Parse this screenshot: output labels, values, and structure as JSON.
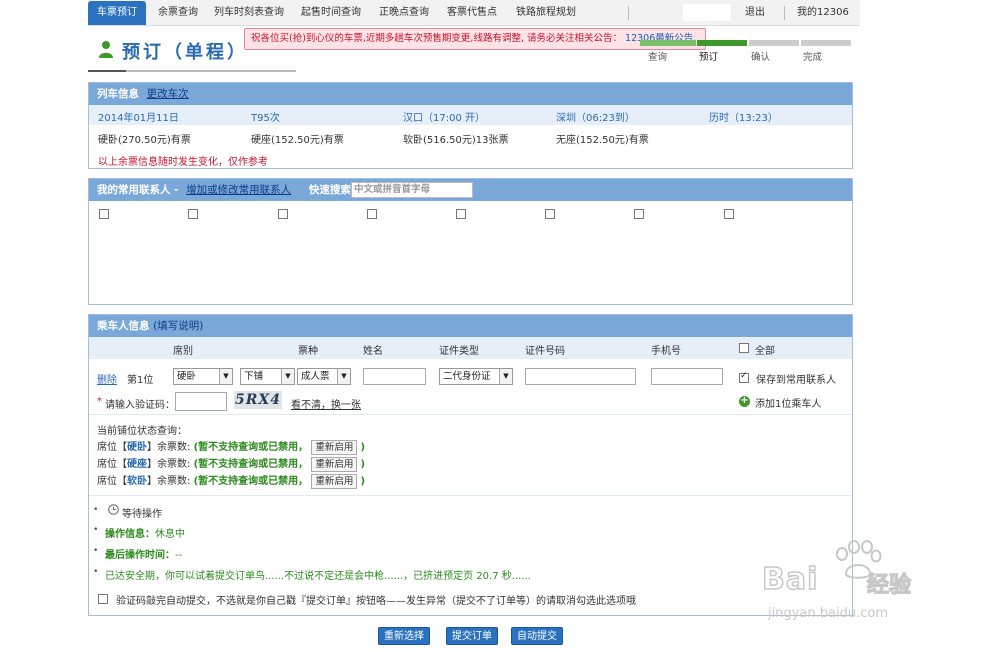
{
  "nav": {
    "items": [
      "车票预订",
      "余票查询",
      "列车时刻表查询",
      "起售时间查询",
      "正晚点查询",
      "客票代售点",
      "铁路旅程规划"
    ],
    "logout": "退出",
    "my12306": "我的12306"
  },
  "page": {
    "title": "预订（单程）"
  },
  "notice": {
    "text": "祝各位买(抢)到心仪的车票,近期多趟车次预售期变更,线路有调整, 请务必关注相关公告：",
    "link": "12306最新公告."
  },
  "steps": [
    "查询",
    "预订",
    "确认",
    "完成"
  ],
  "train": {
    "header": "列车信息",
    "change_link": "更改车次",
    "date": "2014年01月11日",
    "train_no": "T95次",
    "depart": "汉口（17:00 开）",
    "arrive": "深圳（06:23到）",
    "duration": "历时（13:23）",
    "seats": [
      "硬卧(270.50元)有票",
      "硬座(152.50元)有票",
      "软卧(516.50元)13张票",
      "无座(152.50元)有票"
    ],
    "note": "以上余票信息随时发生变化，仅作参考"
  },
  "contacts": {
    "header": "我的常用联系人 -",
    "manage_link": "增加或修改常用联系人",
    "quick_search_label": "快速搜索",
    "search_placeholder": "中文或拼音首字母"
  },
  "passengers": {
    "header": "乘车人信息",
    "help_link": "(填写说明)",
    "columns": [
      "席别",
      "票种",
      "姓名",
      "证件类型",
      "证件号码",
      "手机号",
      "全部"
    ],
    "row": {
      "delete": "删除",
      "position": "第1位",
      "seat": "硬卧",
      "berth": "下铺",
      "ticket_type": "成人票",
      "id_type": "二代身份证",
      "save_contact": "保存到常用联系人"
    },
    "captcha_label": "请输入验证码：",
    "captcha_text": "5RX4",
    "captcha_refresh": "看不清，换一张",
    "add_passenger": "添加1位乘车人"
  },
  "berth_status": {
    "title": "当前铺位状态查询：",
    "rows": [
      {
        "prefix": "席位【",
        "seat": "硬卧",
        "suffix": "】余票数:",
        "status": "(暂不支持查询或已禁用，",
        "button": "重新启用",
        "end": ")"
      },
      {
        "prefix": "席位【",
        "seat": "硬座",
        "suffix": "】余票数:",
        "status": "(暂不支持查询或已禁用，",
        "button": "重新启用",
        "end": ")"
      },
      {
        "prefix": "席位【",
        "seat": "软卧",
        "suffix": "】余票数:",
        "status": "(暂不支持查询或已禁用，",
        "button": "重新启用",
        "end": ")"
      }
    ]
  },
  "operation": {
    "waiting": "等待操作",
    "info_label": "操作信息：",
    "info_value": "休息中",
    "last_time_label": "最后操作时间：",
    "last_time_value": "--",
    "safe_period": "已达安全期，你可以试着提交订单鸟......不过说不定还是会中枪......，已挤进预定页 20.7 秒......",
    "auto_submit_note": "验证码敲完自动提交，不选就是你自己戳『提交订单』按钮咯——发生异常（提交不了订单等）的请取消勾选此选项哦"
  },
  "buttons": {
    "reselect": "重新选择",
    "submit": "提交订单",
    "auto_submit": "自动提交"
  },
  "watermark": {
    "brand": "Bai",
    "brand2": "经验",
    "url": "jingyan.baidu.com"
  }
}
